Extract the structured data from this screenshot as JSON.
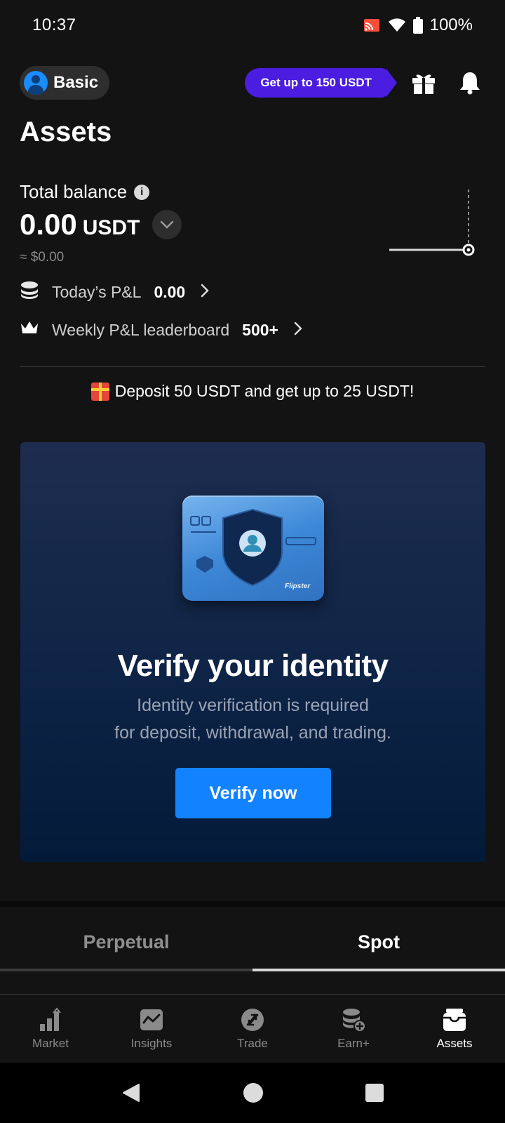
{
  "status_bar": {
    "time": "10:37",
    "battery": "100%"
  },
  "header": {
    "tier_label": "Basic",
    "promo_label": "Get up to 150 USDT"
  },
  "page_title": "Assets",
  "balance": {
    "label": "Total balance",
    "value": "0.00",
    "unit": "USDT",
    "usd_equivalent": "≈ $0.00"
  },
  "pnl": {
    "today_label": "Today’s P&L",
    "today_value": "0.00",
    "leaderboard_label": "Weekly P&L leaderboard",
    "leaderboard_value": "500+"
  },
  "deposit_promo": "Deposit 50 USDT and get up to 25 USDT!",
  "verify": {
    "card_brand": "Flipster",
    "title": "Verify your identity",
    "subtitle_line1": "Identity verification is required",
    "subtitle_line2": "for deposit, withdrawal, and trading.",
    "button_label": "Verify now"
  },
  "tabs": [
    {
      "label": "Perpetual",
      "active": false
    },
    {
      "label": "Spot",
      "active": true
    }
  ],
  "bottom_nav": [
    {
      "label": "Market",
      "icon": "bar-chart-icon"
    },
    {
      "label": "Insights",
      "icon": "insights-icon"
    },
    {
      "label": "Trade",
      "icon": "trade-icon"
    },
    {
      "label": "Earn+",
      "icon": "earn-icon"
    },
    {
      "label": "Assets",
      "icon": "wallet-icon",
      "active": true
    }
  ],
  "colors": {
    "background": "#131313",
    "accent_blue": "#1282ff",
    "promo_purple": "#4a1de0"
  }
}
